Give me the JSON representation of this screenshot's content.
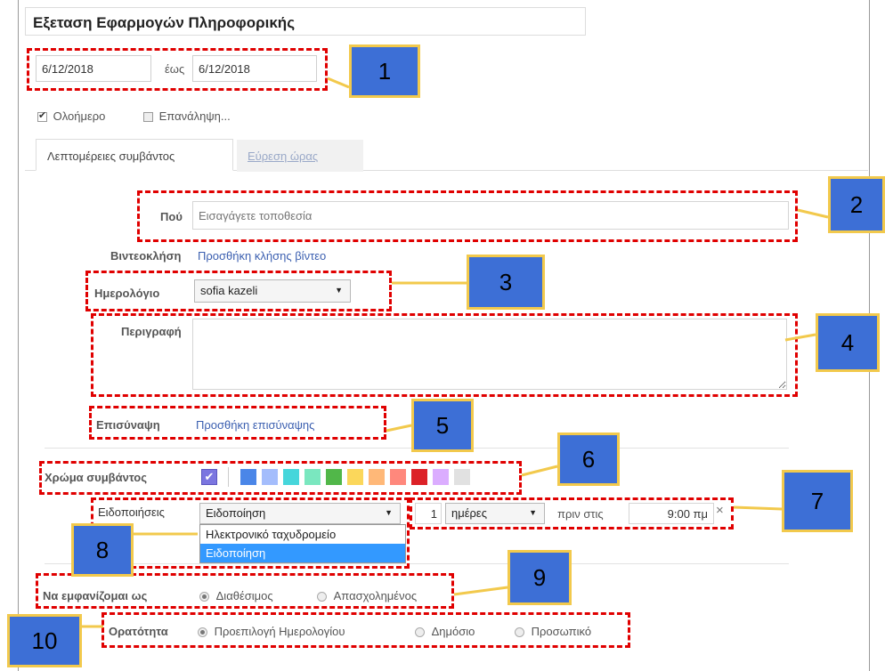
{
  "event": {
    "title": "Εξεταση Εφαρμογών Πληροφορικής",
    "start_date": "6/12/2018",
    "to_label": "έως",
    "end_date": "6/12/2018",
    "all_day_label": "Ολοήμερο",
    "repeat_label": "Επανάληψη..."
  },
  "tabs": [
    {
      "label": "Λεπτομέρειες συμβάντος"
    },
    {
      "label": "Εύρεση ώρας"
    }
  ],
  "details": {
    "where_label": "Πού",
    "where_placeholder": "Εισαγάγετε τοποθεσία",
    "video_label": "Βιντεοκλήση",
    "video_link": "Προσθήκη κλήσης βίντεο",
    "calendar_label": "Ημερολόγιο",
    "calendar_value": "sofia kazeli",
    "description_label": "Περιγραφή",
    "attachment_label": "Επισύναψη",
    "attachment_link": "Προσθήκη επισύναψης",
    "color_label": "Χρώμα συμβάντος",
    "colors": [
      "#7b76e0",
      "#4a86e8",
      "#a4bdfc",
      "#46d6db",
      "#7ae7bf",
      "#51b749",
      "#fbd75b",
      "#ffb878",
      "#ff887c",
      "#dc2127",
      "#dbadff",
      "#e1e1e1"
    ],
    "notifications_label": "Ειδοποιήσεις",
    "notification_type": "Ειδοποίηση",
    "notification_options": [
      "Ηλεκτρονικό ταχυδρομείο",
      "Ειδοποίηση"
    ],
    "notification_amount": "1",
    "notification_unit": "ημέρες",
    "before_at_label": "πριν στις",
    "notification_time": "9:00 πμ",
    "remove_symbol": "×",
    "show_as_label": "Να εμφανίζομαι ως",
    "show_as_options": [
      "Διαθέσιμος",
      "Απασχολημένος"
    ],
    "visibility_label": "Ορατότητα",
    "visibility_options": [
      "Προεπιλογή Ημερολογίου",
      "Δημόσιο",
      "Προσωπικό"
    ]
  },
  "callouts": [
    "1",
    "2",
    "3",
    "4",
    "5",
    "6",
    "7",
    "8",
    "9",
    "10"
  ],
  "icons": {
    "dropdown": "▼",
    "check": "✔"
  }
}
